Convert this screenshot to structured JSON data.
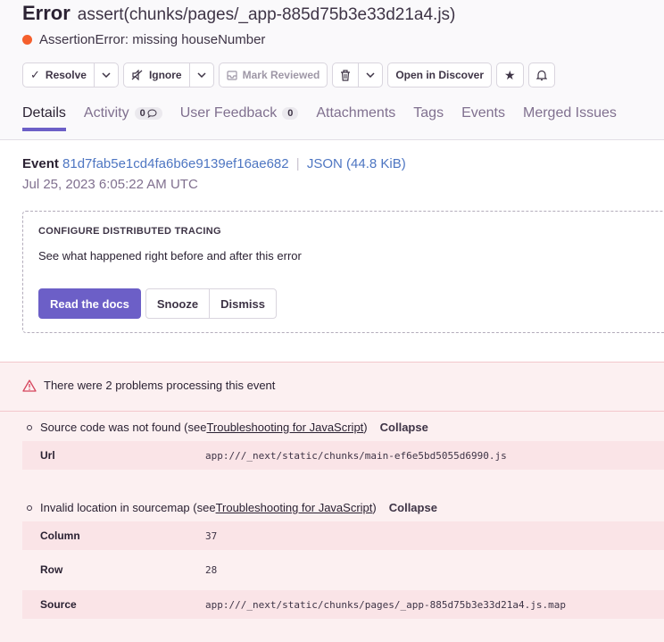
{
  "header": {
    "type": "Error",
    "subtitle": "assert(chunks/pages/_app-885d75b3e33d21a4.js)",
    "message": "AssertionError: missing houseNumber",
    "status_color": "#f55f2c"
  },
  "actions": {
    "resolve": "Resolve",
    "ignore": "Ignore",
    "mark_reviewed": "Mark Reviewed",
    "open_discover": "Open in Discover"
  },
  "tabs": [
    {
      "label": "Details"
    },
    {
      "label": "Activity",
      "badge": "0"
    },
    {
      "label": "User Feedback",
      "badge": "0"
    },
    {
      "label": "Attachments"
    },
    {
      "label": "Tags"
    },
    {
      "label": "Events"
    },
    {
      "label": "Merged Issues"
    }
  ],
  "event": {
    "label": "Event",
    "id": "81d7fab5e1cd4fa6b6e9139ef16ae682",
    "json": "JSON (44.8 KiB)",
    "date": "Jul 25, 2023 6:05:22 AM UTC"
  },
  "tracing": {
    "title": "CONFIGURE DISTRIBUTED TRACING",
    "desc": "See what happened right before and after this error",
    "read_docs": "Read the docs",
    "snooze": "Snooze",
    "dismiss": "Dismiss"
  },
  "problems": {
    "title": "There were 2 problems processing this event",
    "items": [
      {
        "prefix": "Source code was not found (see ",
        "link": "Troubleshooting for JavaScript",
        "suffix": ")",
        "collapse": "Collapse",
        "rows": [
          {
            "key": "Url",
            "value": "app:///_next/static/chunks/main-ef6e5bd5055d6990.js"
          }
        ]
      },
      {
        "prefix": "Invalid location in sourcemap (see ",
        "link": "Troubleshooting for JavaScript",
        "suffix": ")",
        "collapse": "Collapse",
        "rows": [
          {
            "key": "Column",
            "value": "37"
          },
          {
            "key": "Row",
            "value": "28"
          },
          {
            "key": "Source",
            "value": "app:///_next/static/chunks/pages/_app-885d75b3e33d21a4.js.map"
          }
        ]
      }
    ]
  },
  "colors": {
    "accent": "#6c5fc7",
    "link": "#4e76c2",
    "danger_bg": "#fcf0f1"
  }
}
